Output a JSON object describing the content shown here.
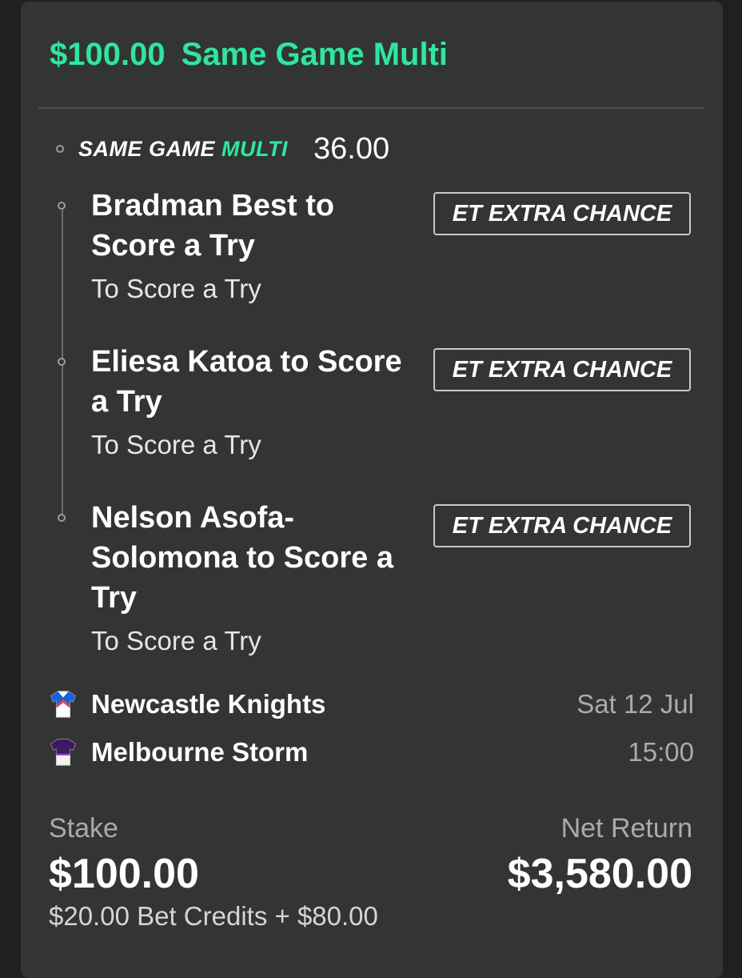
{
  "header": {
    "stake_amount": "$100.00",
    "bet_type": "Same Game Multi"
  },
  "sgm": {
    "logo_word_1": "SAME GAME",
    "logo_word_2": "MULTI",
    "odds": "36.00"
  },
  "legs": [
    {
      "title": "Bradman Best to Score a Try",
      "market": "To Score a Try",
      "badge": "ET EXTRA CHANCE"
    },
    {
      "title": "Eliesa Katoa to Score a Try",
      "market": "To Score a Try",
      "badge": "ET EXTRA CHANCE"
    },
    {
      "title": "Nelson Asofa-Solomona to Score a Try",
      "market": "To Score a Try",
      "badge": "ET EXTRA CHANCE"
    }
  ],
  "match": {
    "home_team": "Newcastle Knights",
    "away_team": "Melbourne Storm",
    "date": "Sat 12 Jul",
    "time": "15:00",
    "home_jersey_icon": "newcastle-jersey-icon",
    "away_jersey_icon": "melbourne-jersey-icon"
  },
  "summary": {
    "stake_label": "Stake",
    "stake_value": "$100.00",
    "stake_breakdown": "$20.00 Bet Credits + $80.00",
    "return_label": "Net Return",
    "return_value": "$3,580.00"
  },
  "colors": {
    "accent": "#2ee6a1",
    "card_bg": "#323533",
    "page_bg": "#1f2120"
  }
}
